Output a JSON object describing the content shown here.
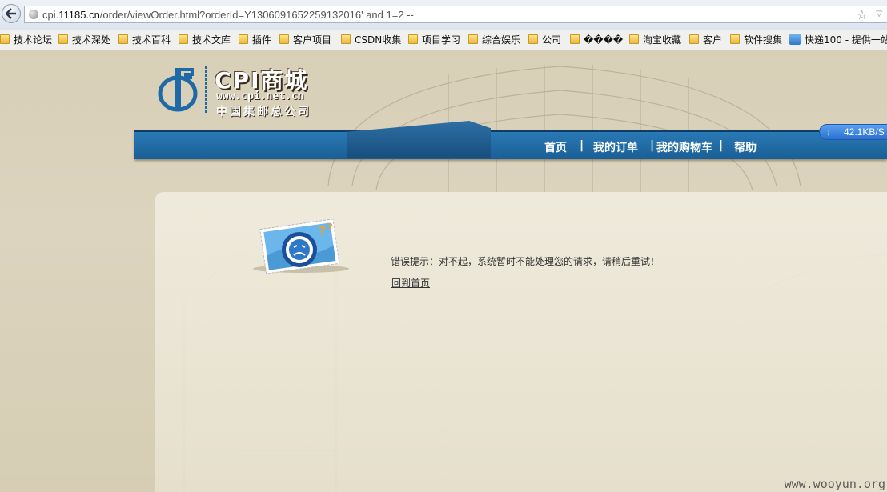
{
  "browser": {
    "url_prefix": "cpi.",
    "url_host": "11185.cn",
    "url_path": "/order/viewOrder.html?orderId=Y1306091652259132016' and 1=2 --"
  },
  "bookmarks": [
    {
      "label": "技术论坛"
    },
    {
      "label": "技术深处"
    },
    {
      "label": "技术百科"
    },
    {
      "label": "技术文库"
    },
    {
      "label": "插件"
    },
    {
      "label": "客户项目"
    },
    {
      "label": "CSDN收集"
    },
    {
      "label": "项目学习"
    },
    {
      "label": "综合娱乐"
    },
    {
      "label": "公司"
    },
    {
      "label": "����"
    },
    {
      "label": "淘宝收藏"
    },
    {
      "label": "客户"
    },
    {
      "label": "软件搜集"
    },
    {
      "label": "快递100 - 提供一站"
    }
  ],
  "logo": {
    "title": "CPI商城",
    "website": "www.cpi.net.cn",
    "company": "中国集邮总公司"
  },
  "nav": {
    "home": "首页",
    "orders": "我的订单",
    "cart": "我的购物车",
    "help": "帮助",
    "sep": "|"
  },
  "content": {
    "error_message": "错误提示：对不起，系统暂时不能处理您的请求，请稍后重试！",
    "home_link": "回到首页"
  },
  "download": {
    "speed": "42.1KB/S"
  },
  "watermark": "www.wooyun.org",
  "colors": {
    "nav_blue": "#1f6aa6",
    "page_bg": "#d8cfb8"
  }
}
